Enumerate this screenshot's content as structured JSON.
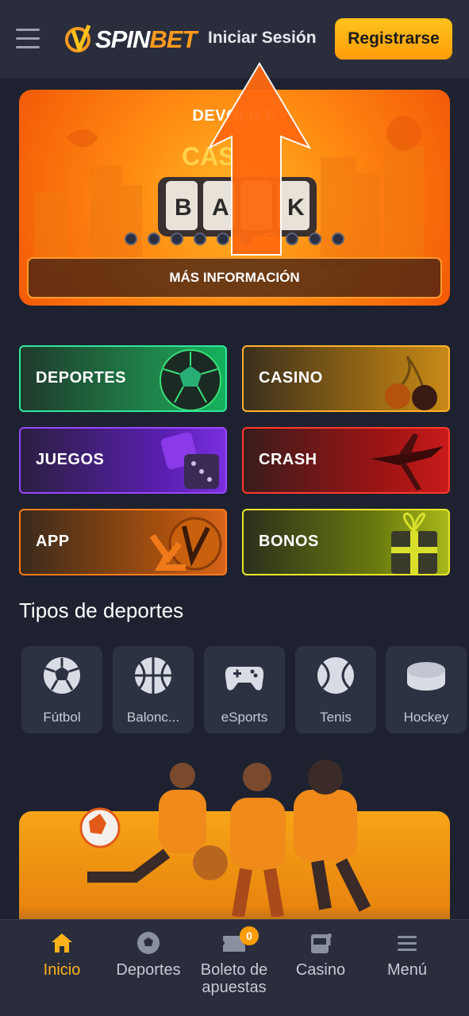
{
  "header": {
    "logo_prefix": "SPIN",
    "logo_suffix": "BET",
    "login_label": "Iniciar Sesión",
    "register_label": "Registrarse"
  },
  "promo": {
    "title": "DEVOLUCIÓN DE CASHBACK",
    "title_visible": "DEVOLU        P",
    "more_info_label": "MÁS INFORMACIÓN",
    "slides_count": 10,
    "active_slide": 7
  },
  "categories": [
    {
      "label": "DEPORTES"
    },
    {
      "label": "CASINO"
    },
    {
      "label": "JUEGOS"
    },
    {
      "label": "CRASH"
    },
    {
      "label": "APP"
    },
    {
      "label": "BONOS"
    }
  ],
  "sports_section": {
    "title": "Tipos de deportes",
    "items": [
      {
        "name": "Fútbol",
        "icon": "soccer-ball-icon"
      },
      {
        "name": "Balonc...",
        "icon": "basketball-icon"
      },
      {
        "name": "eSports",
        "icon": "gamepad-icon"
      },
      {
        "name": "Tenis",
        "icon": "tennis-ball-icon"
      },
      {
        "name": "Hockey",
        "icon": "hockey-puck-icon"
      }
    ]
  },
  "bottom_nav": [
    {
      "label": "Inicio",
      "icon": "home-icon",
      "active": true
    },
    {
      "label": "Deportes",
      "icon": "soccer-ball-icon"
    },
    {
      "label": "Boleto de apuestas",
      "icon": "ticket-icon",
      "badge": "0"
    },
    {
      "label": "Casino",
      "icon": "slot-machine-icon"
    },
    {
      "label": "Menú",
      "icon": "menu-icon"
    }
  ],
  "colors": {
    "accent": "#ffb01a",
    "background": "#1e2230",
    "header": "#2a2e3c"
  }
}
